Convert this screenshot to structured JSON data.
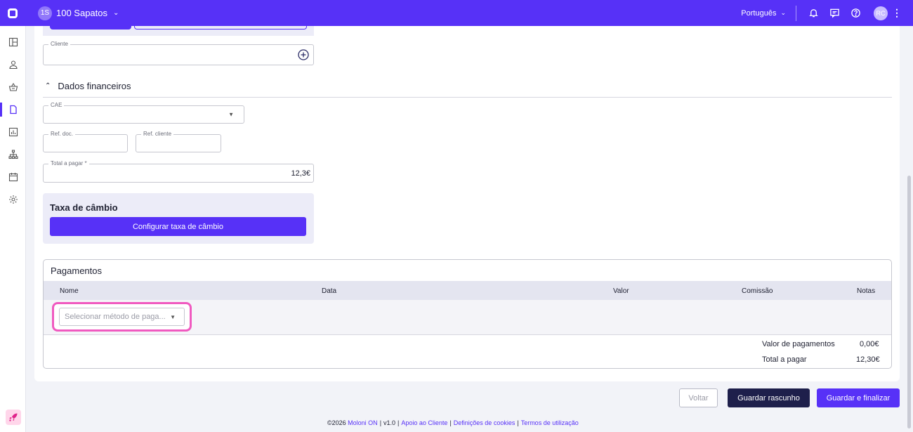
{
  "header": {
    "company_initials": "1S",
    "company_name": "100 Sapatos",
    "language": "Português",
    "user_initials": "RC"
  },
  "sidebar": {
    "items": [
      "dashboard-icon",
      "contacts-icon",
      "basket-icon",
      "document-icon",
      "reports-icon",
      "hierarchy-icon",
      "calendar-icon",
      "settings-icon"
    ],
    "active_index": 3
  },
  "form": {
    "cliente_label": "Cliente",
    "section_title": "Dados financeiros",
    "cae_label": "CAE",
    "ref_doc_label": "Ref. doc.",
    "ref_cliente_label": "Ref. cliente",
    "total_label": "Total a pagar *",
    "total_value": "12,3€"
  },
  "cambio": {
    "title": "Taxa de câmbio",
    "button": "Configurar taxa de câmbio"
  },
  "pagamentos": {
    "title": "Pagamentos",
    "columns": [
      "Nome",
      "Data",
      "Valor",
      "Comissão",
      "Notas"
    ],
    "select_placeholder": "Selecionar método de paga...",
    "summary": [
      {
        "label": "Valor de pagamentos",
        "value": "0,00€"
      },
      {
        "label": "Total a pagar",
        "value": "12,30€"
      }
    ]
  },
  "actions": {
    "voltar": "Voltar",
    "rascunho": "Guardar rascunho",
    "finalizar": "Guardar e finalizar"
  },
  "footer": {
    "copyright": "©2026",
    "brand": "Moloni ON",
    "version": "v1.0",
    "apoio": "Apoio ao Cliente",
    "cookies": "Definições de cookies",
    "termos": "Termos de utilização"
  },
  "colors": {
    "primary": "#5731f7",
    "dark": "#1e1f4b",
    "highlight": "#f05ac0"
  }
}
